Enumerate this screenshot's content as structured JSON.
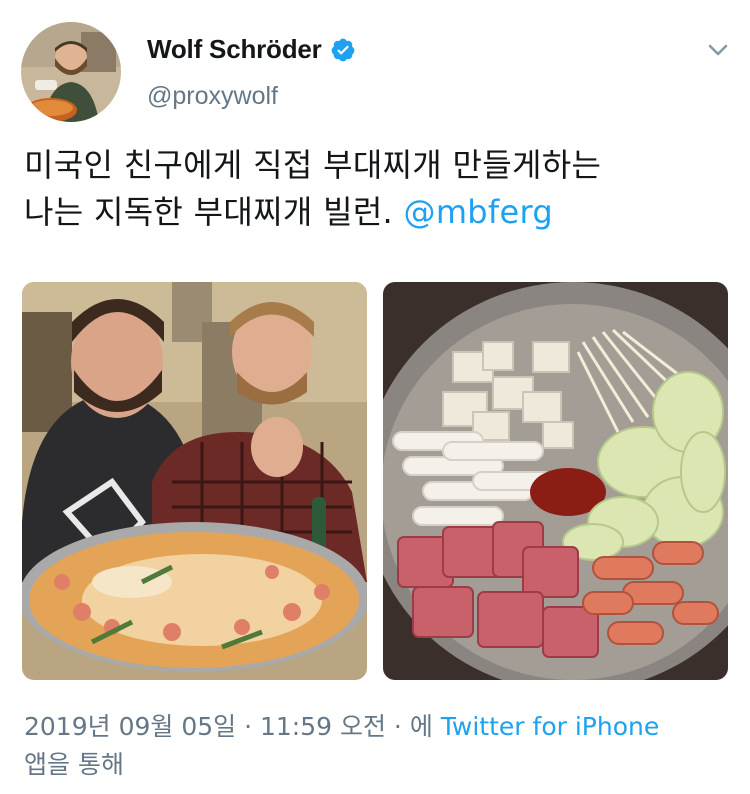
{
  "user": {
    "display_name": "Wolf Schröder",
    "handle": "@proxywolf",
    "verified": true,
    "avatar_icon": "profile-avatar-photo"
  },
  "tweet": {
    "text_line1": "미국인 친구에게 직접 부대찌개 만들게하는",
    "text_line2": "나는 지독한 부대찌개 빌런.",
    "mention": "@mbferg"
  },
  "media": [
    {
      "name": "photo-two-men-with-stew",
      "icon": "photo-image"
    },
    {
      "name": "photo-raw-stew-ingredients",
      "icon": "photo-image"
    }
  ],
  "meta": {
    "timestamp": "2019년 09월 05일 · 11:59 오전 · 에",
    "source": "Twitter for iPhone",
    "suffix": "앱을 통해"
  },
  "colors": {
    "accent": "#1da1f2",
    "text": "#14171a",
    "secondary": "#657786"
  }
}
